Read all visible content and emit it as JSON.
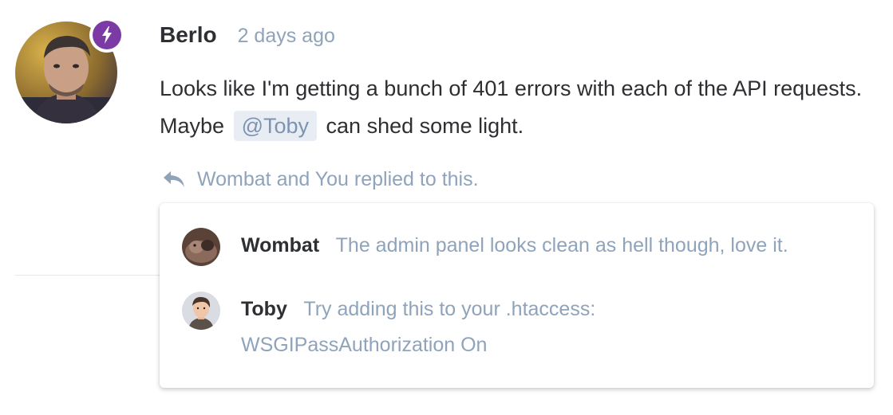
{
  "colors": {
    "badge": "#7b3aa4",
    "author": "#2d2f33",
    "muted": "#8fa3bb",
    "mention_bg": "#e8edf4",
    "mention_text": "#7c93b2"
  },
  "post": {
    "author": "Berlo",
    "time": "2 days ago",
    "avatar_icon": "user-avatar",
    "badge_icon": "lightning-bolt-icon",
    "body_before_mention": "Looks like I'm getting a bunch of 401 errors with each of the API requests. Maybe",
    "mention": "@Toby",
    "body_after_mention": "can shed some light."
  },
  "replies_summary": {
    "icon": "reply-arrow-icon",
    "text": "Wombat and You replied to this."
  },
  "replies": [
    {
      "author": "Wombat",
      "text": "The admin panel looks clean as hell though, love it.",
      "avatar_icon": "user-avatar"
    },
    {
      "author": "Toby",
      "text": "Try adding this to your .htaccess:",
      "code": "WSGIPassAuthorization On",
      "avatar_icon": "user-avatar"
    }
  ]
}
